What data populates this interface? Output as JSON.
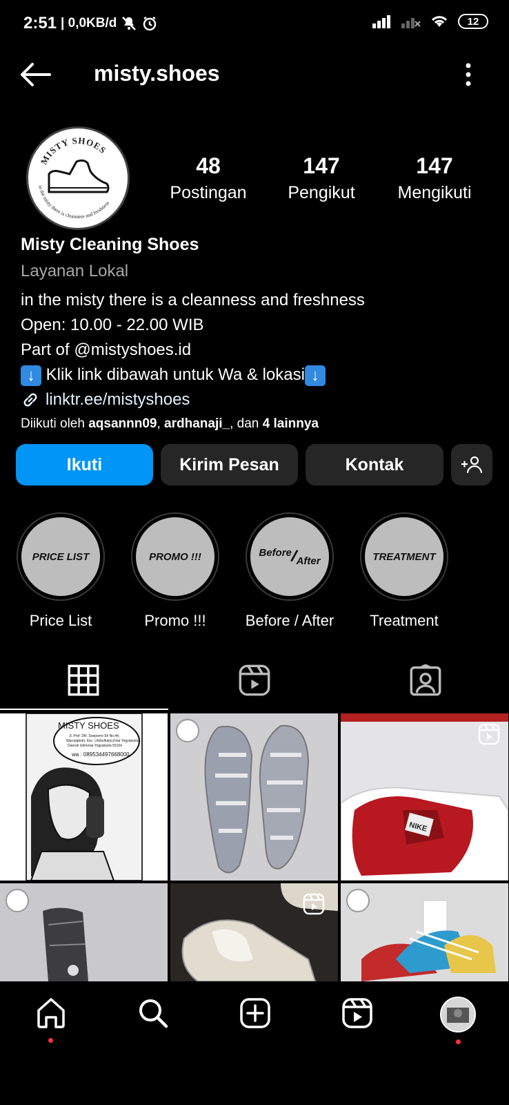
{
  "status": {
    "time": "2:51",
    "net": "| 0,0KB/d",
    "battery": "12"
  },
  "header": {
    "title": "misty.shoes"
  },
  "avatar": {
    "logo_top": "MISTY SHOES",
    "logo_bottom": "in the misty there is cleanness and freshness"
  },
  "stats": [
    {
      "num": "48",
      "label": "Postingan"
    },
    {
      "num": "147",
      "label": "Pengikut"
    },
    {
      "num": "147",
      "label": "Mengikuti"
    }
  ],
  "bio": {
    "name": "Misty Cleaning Shoes",
    "category": "Layanan Lokal",
    "line1": "in the misty there is a cleanness and freshness",
    "line2": "Open: 10.00 - 22.00 WIB",
    "line3": "Part of @mistyshoes.id",
    "line4": "Klik link dibawah untuk Wa & lokasi",
    "link": "linktr.ee/mistyshoes",
    "followed_prefix": "Diikuti oleh",
    "followed_user1": "aqsannn09",
    "followed_user2": "ardhanaji_",
    "followed_mid": "dan",
    "followed_more": "4 lainnya"
  },
  "buttons": {
    "follow": "Ikuti",
    "message": "Kirim Pesan",
    "contact": "Kontak"
  },
  "highlights": [
    {
      "cover": "PRICE LIST",
      "label": "Price List"
    },
    {
      "cover": "PROMO !!!",
      "label": "Promo !!!"
    },
    {
      "cover_a": "Before",
      "cover_b": "After",
      "label": "Before / After"
    },
    {
      "cover": "TREATMENT",
      "label": "Treatment"
    }
  ],
  "posts": {
    "post1": {
      "brand": "MISTY SHOES",
      "address1": "Jl. Prof. DR. Soepomo Sh No.44,",
      "address2": "Warungboto, Kec. Umbulharjo,Kota Yogyakarta,",
      "address3": "Daerah Istimewa Yogyakarta 55164",
      "wa": "wa : 089534497668000"
    },
    "post3_brand": "NIKE"
  },
  "colors": {
    "primary": "#0095f6",
    "button": "#262626",
    "notification": "#ff3040"
  }
}
